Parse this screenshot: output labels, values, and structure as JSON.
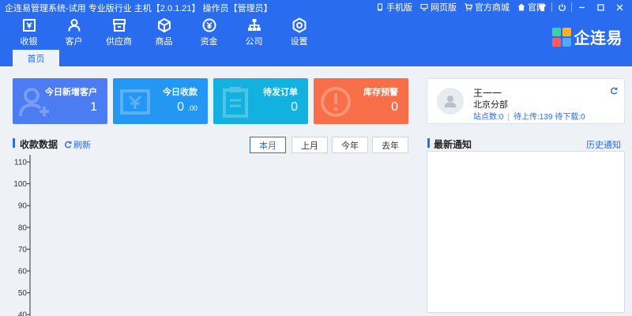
{
  "window": {
    "title": "企连易管理系统-试用 专业版行业 主机【2.0.1.21】 操作员【管理员】",
    "top_links": [
      {
        "label": "手机版",
        "icon": "mobile-icon"
      },
      {
        "label": "网页版",
        "icon": "monitor-icon"
      },
      {
        "label": "官方商城",
        "icon": "cart-icon"
      },
      {
        "label": "官网",
        "icon": "home-icon"
      }
    ]
  },
  "nav": [
    {
      "label": "收银",
      "icon": "cashier-icon"
    },
    {
      "label": "客户",
      "icon": "customer-icon"
    },
    {
      "label": "供应商",
      "icon": "supplier-icon"
    },
    {
      "label": "商品",
      "icon": "product-icon"
    },
    {
      "label": "资金",
      "icon": "funds-icon"
    },
    {
      "label": "公司",
      "icon": "company-icon"
    },
    {
      "label": "设置",
      "icon": "settings-icon"
    }
  ],
  "brand": {
    "name": "企连易"
  },
  "tabs": [
    {
      "label": "首页"
    }
  ],
  "cards": [
    {
      "label": "今日新增客户",
      "value": "1",
      "color": "#4b7cf2",
      "icon": "add-user-icon"
    },
    {
      "label": "今日收款",
      "value": "0",
      "decimals": ".00",
      "color": "#2397f3",
      "icon": "cashier-icon"
    },
    {
      "label": "待发订单",
      "value": "0",
      "color": "#13b1df",
      "icon": "clipboard-icon"
    },
    {
      "label": "库存预警",
      "value": "0",
      "color": "#f76f48",
      "icon": "alert-icon"
    }
  ],
  "user": {
    "name": "王一一",
    "branch": "北京分部",
    "site_count_label": "站点数:0",
    "uploading_label": "待上传:139",
    "downloading_label": "待下载:0"
  },
  "collection": {
    "title": "收款数据",
    "refresh_label": "刷新",
    "periods": [
      "本月",
      "上月",
      "今年",
      "去年"
    ],
    "active_period": "本月"
  },
  "notices": {
    "title": "最新通知",
    "history_label": "历史通知"
  },
  "chart_data": {
    "type": "line",
    "yticks": [
      110,
      100,
      90,
      80,
      70,
      60,
      50,
      40
    ],
    "ylim": [
      40,
      110
    ],
    "series": []
  }
}
